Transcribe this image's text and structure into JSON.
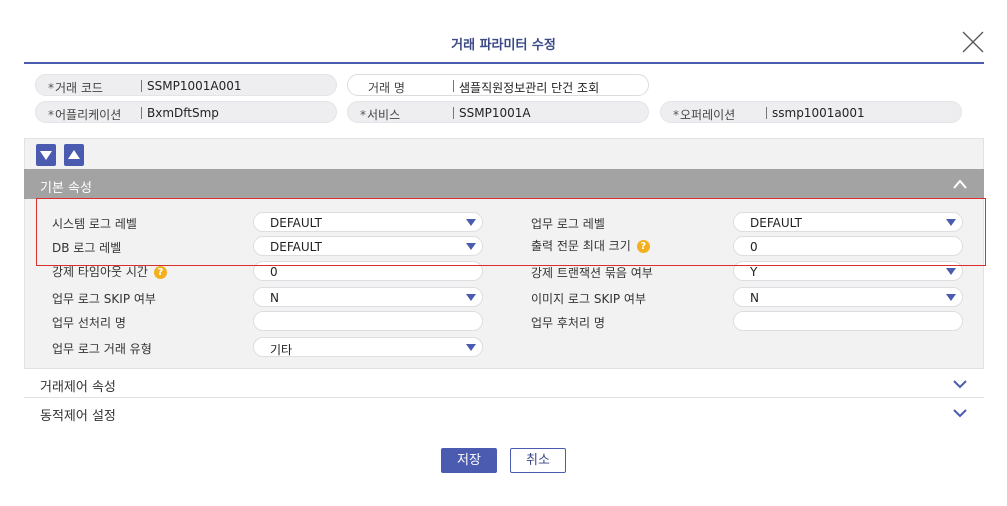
{
  "dialog": {
    "title": "거래 파라미터 수정",
    "close_icon": "close-icon"
  },
  "header_fields": [
    {
      "label": "거래 코드",
      "required": true,
      "value": "SSMP1001A001"
    },
    {
      "label": "거래 명",
      "required": false,
      "value": "샘플직원정보관리 단건 조회"
    },
    {
      "label": "어플리케이션",
      "required": true,
      "value": "BxmDftSmp"
    },
    {
      "label": "서비스",
      "required": true,
      "value": "SSMP1001A"
    },
    {
      "label": "오퍼레이션",
      "required": true,
      "value": "ssmp1001a001"
    }
  ],
  "required_mark": "*",
  "toolbar": {
    "expand_all_icon": "arrow-down-icon",
    "collapse_all_icon": "arrow-up-icon"
  },
  "basic_section": {
    "title": "기본 속성",
    "fields": [
      {
        "label": "시스템 로그 레벨",
        "value": "DEFAULT",
        "type": "select"
      },
      {
        "label": "업무 로그 레벨",
        "value": "DEFAULT",
        "type": "select"
      },
      {
        "label": "DB 로그 레벨",
        "value": "DEFAULT",
        "type": "select"
      },
      {
        "label": "출력 전문 최대 크기",
        "value": "0",
        "type": "text",
        "help": true
      },
      {
        "label": "강제 타임아웃 시간",
        "value": "0",
        "type": "text",
        "help": true
      },
      {
        "label": "강제 트랜잭션 묶음 여부",
        "value": "Y",
        "type": "select"
      },
      {
        "label": "업무 로그 SKIP 여부",
        "value": "N",
        "type": "select"
      },
      {
        "label": "이미지 로그 SKIP 여부",
        "value": "N",
        "type": "select"
      },
      {
        "label": "업무 선처리 명",
        "value": "",
        "type": "text"
      },
      {
        "label": "업무 후처리 명",
        "value": "",
        "type": "text"
      },
      {
        "label": "업무 로그 거래 유형",
        "value": "기타",
        "type": "select"
      }
    ],
    "help_mark": "?"
  },
  "sections": [
    {
      "title": "거래제어 속성"
    },
    {
      "title": "동적제어 설정"
    }
  ],
  "footer": {
    "save_label": "저장",
    "cancel_label": "취소"
  },
  "colors": {
    "accent": "#4a5bb0",
    "section_bar": "#a3a3a3",
    "highlight": "#d9302f",
    "help": "#f2b01e"
  }
}
